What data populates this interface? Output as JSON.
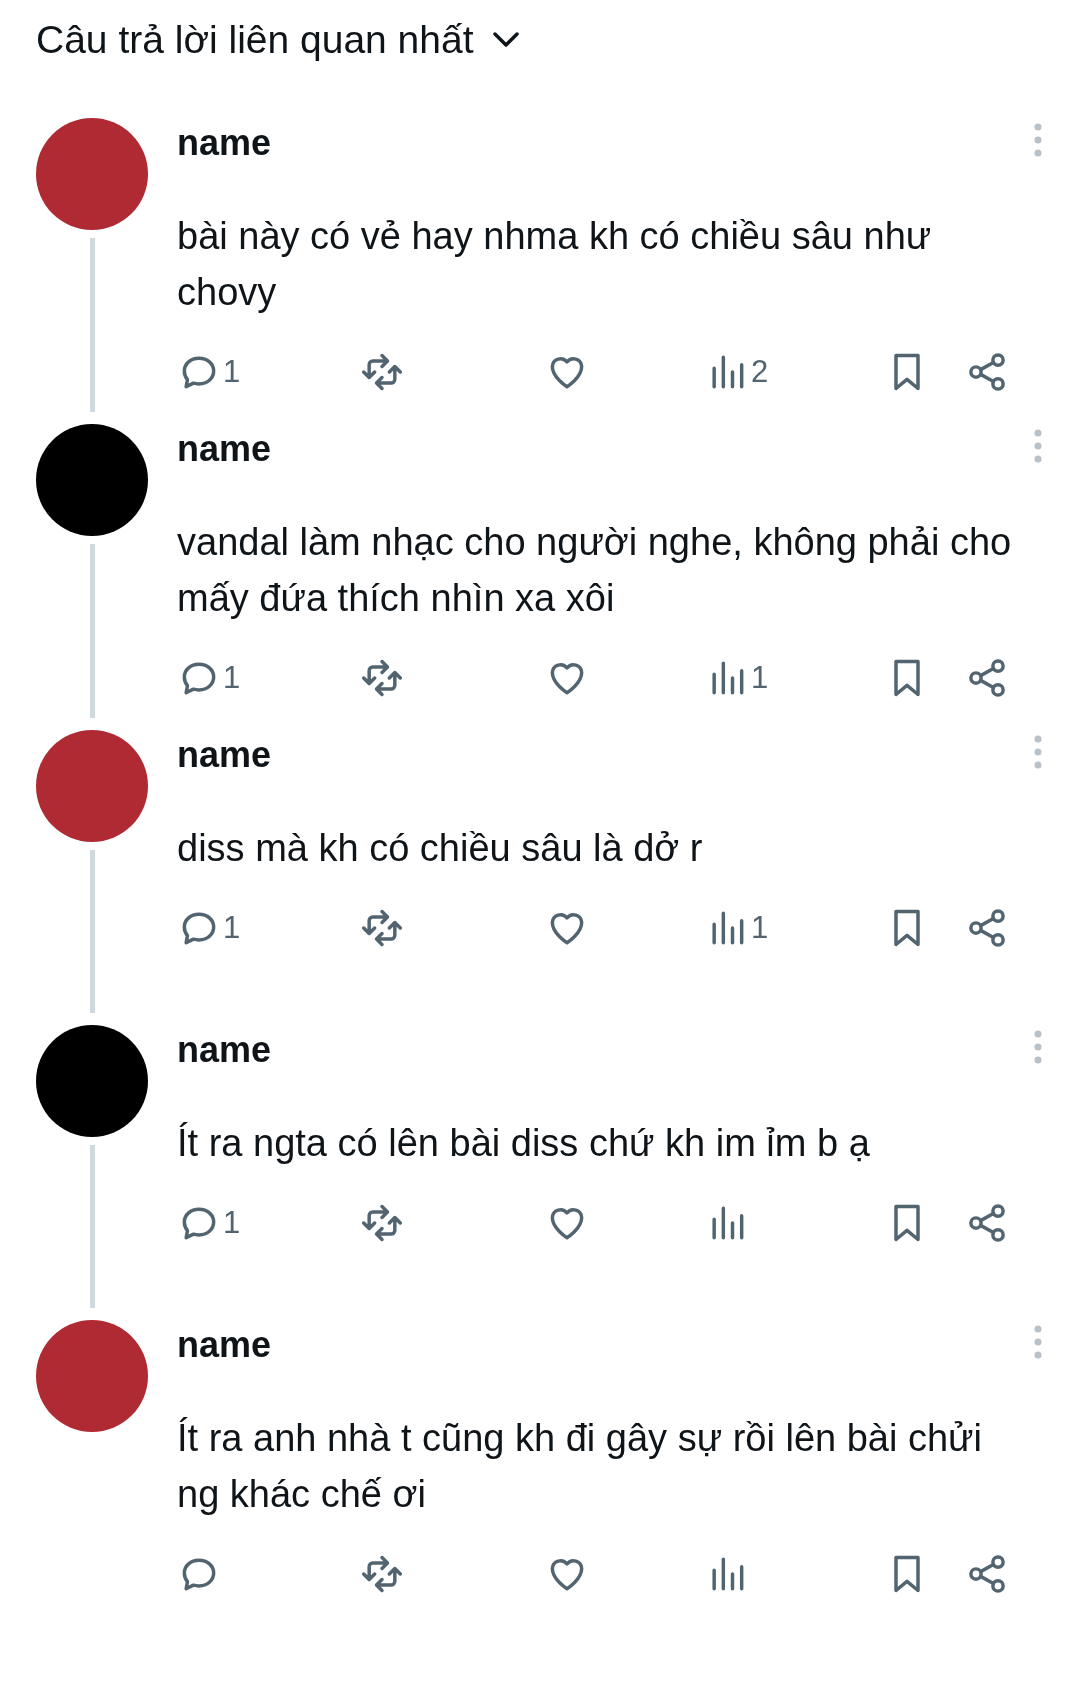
{
  "header": {
    "title": "Câu trả lời liên quan nhất"
  },
  "replies": [
    {
      "name": "name",
      "color": "#b02a33",
      "text": "bài này có vẻ hay nhma kh có chiều sâu như chovy",
      "reply_count": "1",
      "view_count": "2"
    },
    {
      "name": "name",
      "color": "#000000",
      "text": "vandal làm nhạc cho người nghe, không phải cho mấy đứa thích nhìn xa xôi",
      "reply_count": "1",
      "view_count": "1"
    },
    {
      "name": "name",
      "color": "#b02a33",
      "text": "diss mà kh có chiều sâu là dở r",
      "reply_count": "1",
      "view_count": "1"
    },
    {
      "name": "name",
      "color": "#000000",
      "text": "Ít ra ngta có lên bài diss chứ kh im ỉm b ạ",
      "reply_count": "1"
    },
    {
      "name": "name",
      "color": "#b02a33",
      "text": "Ít ra anh nhà t cũng kh đi gây sự rồi lên bài chửi ng khác chế ơi"
    }
  ]
}
